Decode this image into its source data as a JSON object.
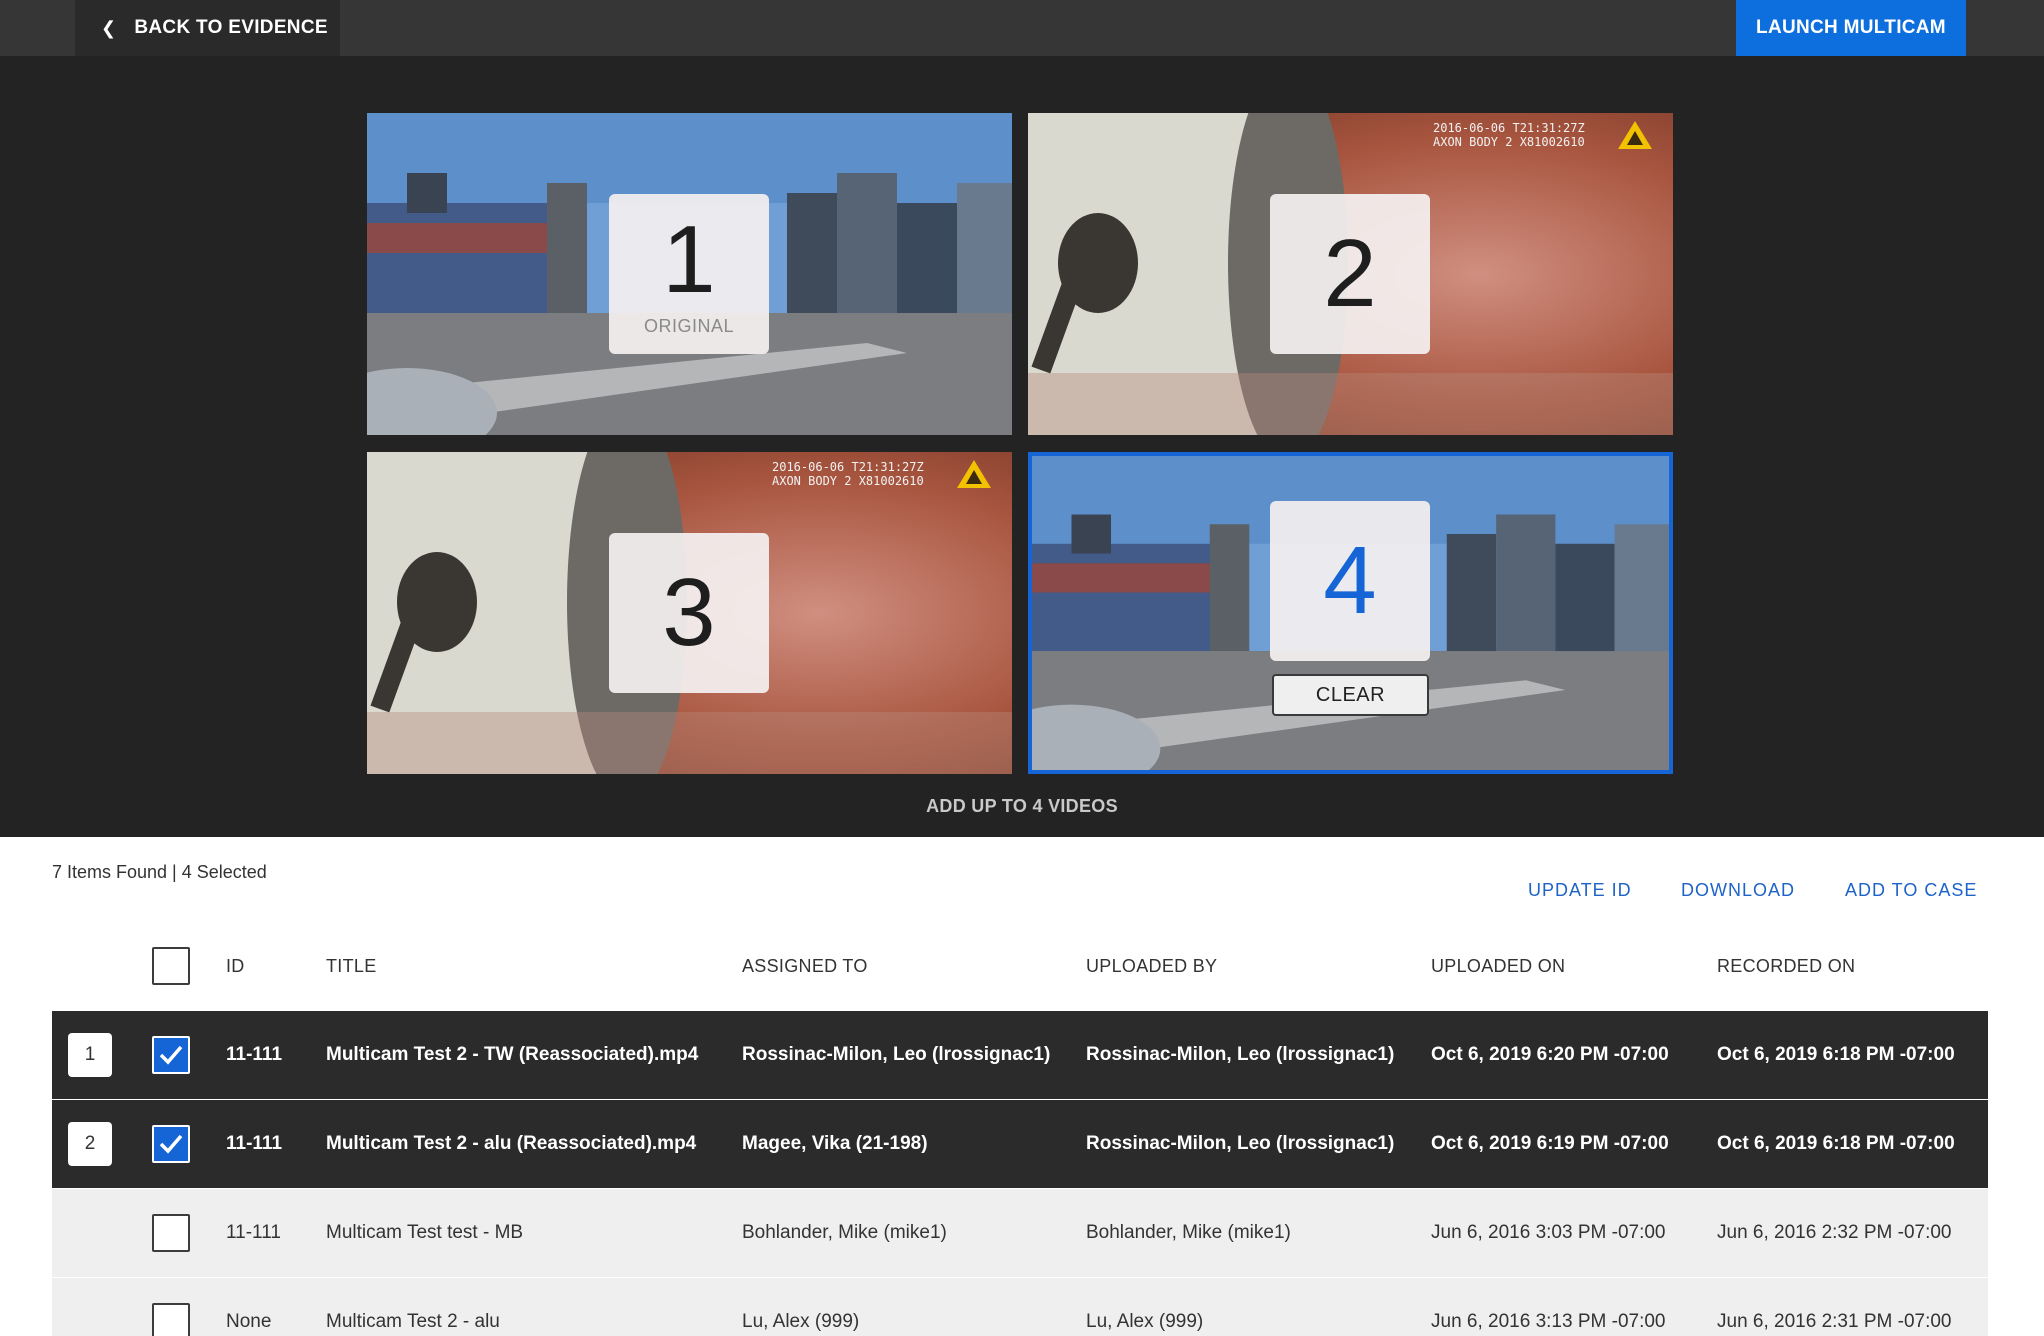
{
  "topbar": {
    "back_label": "BACK TO EVIDENCE",
    "launch_label": "LAUNCH MULTICAM"
  },
  "tiles": [
    {
      "number": "1",
      "sub": "ORIGINAL"
    },
    {
      "number": "2",
      "overlay": "2016-06-06 T21:31:27Z\nAXON BODY 2 X81002610"
    },
    {
      "number": "3",
      "overlay": "2016-06-06 T21:31:27Z\nAXON BODY 2 X81002610"
    },
    {
      "number": "4",
      "clear_label": "CLEAR"
    }
  ],
  "add_up_label": "ADD UP TO 4 VIDEOS",
  "summary": "7 Items Found | 4 Selected",
  "actions": {
    "update_id": "UPDATE ID",
    "download": "DOWNLOAD",
    "add_to_case": "ADD TO CASE"
  },
  "columns": {
    "id": "ID",
    "title": "TITLE",
    "assigned_to": "ASSIGNED TO",
    "uploaded_by": "UPLOADED BY",
    "uploaded_on": "UPLOADED ON",
    "recorded_on": "RECORDED ON"
  },
  "rows": [
    {
      "order": "1",
      "checked": true,
      "id": "11-111",
      "title": "Multicam Test 2 - TW (Reassociated).mp4",
      "assigned_to": "Rossinac-Milon, Leo (lrossignac1)",
      "uploaded_by": "Rossinac-Milon, Leo (lrossignac1)",
      "uploaded_on": "Oct 6, 2019 6:20 PM -07:00",
      "recorded_on": "Oct 6, 2019 6:18 PM -07:00"
    },
    {
      "order": "2",
      "checked": true,
      "id": "11-111",
      "title": "Multicam Test 2 - alu (Reassociated).mp4",
      "assigned_to": "Magee, Vika (21-198)",
      "uploaded_by": "Rossinac-Milon, Leo (lrossignac1)",
      "uploaded_on": "Oct 6, 2019 6:19 PM -07:00",
      "recorded_on": "Oct 6, 2019 6:18 PM -07:00"
    },
    {
      "order": "",
      "checked": false,
      "id": "11-111",
      "title": "Multicam Test test - MB",
      "assigned_to": "Bohlander, Mike (mike1)",
      "uploaded_by": "Bohlander, Mike (mike1)",
      "uploaded_on": "Jun 6, 2016 3:03 PM -07:00",
      "recorded_on": "Jun 6, 2016 2:32 PM -07:00"
    },
    {
      "order": "",
      "checked": false,
      "id": "None",
      "title": "Multicam Test 2 - alu",
      "assigned_to": "Lu, Alex (999)",
      "uploaded_by": "Lu, Alex (999)",
      "uploaded_on": "Jun 6, 2016 3:13 PM -07:00",
      "recorded_on": "Jun 6, 2016 2:31 PM -07:00"
    }
  ],
  "colors": {
    "accent": "#1565d6",
    "dark_row": "#2b2b2b",
    "light_row": "#efefef"
  }
}
